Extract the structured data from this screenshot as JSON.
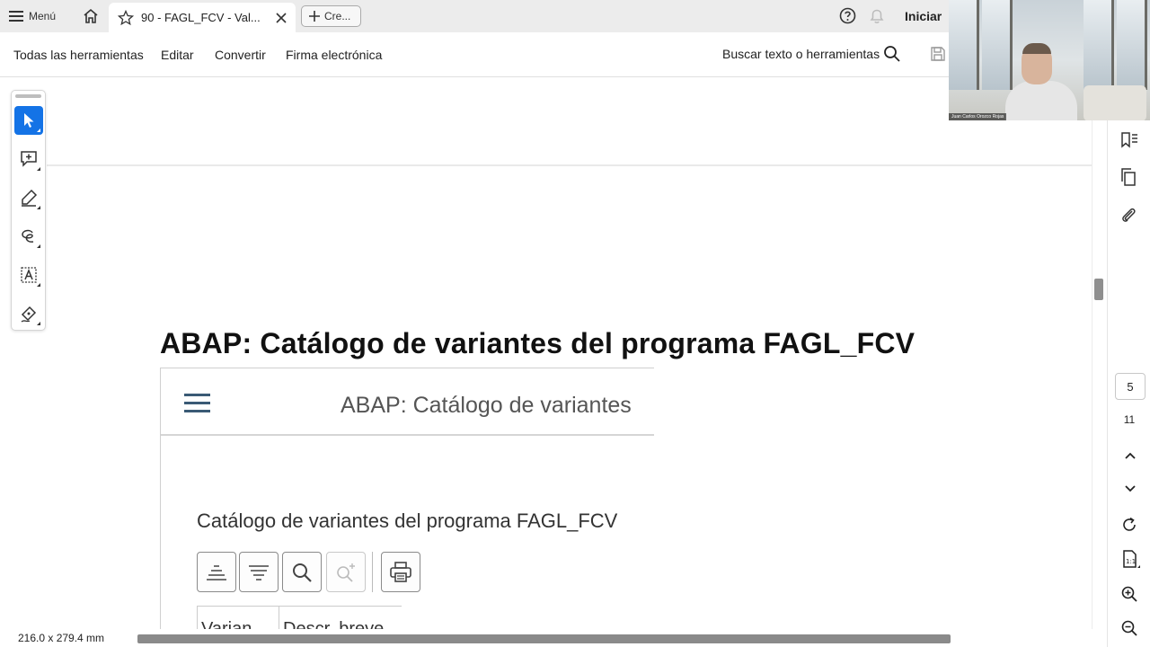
{
  "browser": {
    "menu_label": "Menú",
    "active_tab_title": "90 - FAGL_FCV - Val...",
    "new_tab_label": "Cre...",
    "sign_in_label": "Iniciar"
  },
  "toolbar": {
    "all_tools": "Todas las herramientas",
    "edit": "Editar",
    "convert": "Convertir",
    "esign": "Firma electrónica",
    "search_label": "Buscar texto o herramientas"
  },
  "webcam": {
    "participant_name": "Juan Carlos Orozco Rojas"
  },
  "document": {
    "heading": "ABAP: Catálogo de variantes del programa FAGL_FCV",
    "embedded": {
      "header_title": "ABAP: Catálogo de variantes",
      "subtitle": "Catálogo de variantes del programa FAGL_FCV",
      "columns": [
        "Varian...",
        "Descr. breve"
      ]
    }
  },
  "navigation": {
    "current_page": "5",
    "total_pages": "11"
  },
  "status": {
    "page_dimensions": "216.0 x 279.4 mm"
  },
  "colors": {
    "accent": "#1473e6",
    "tab_bar": "#ececec"
  }
}
